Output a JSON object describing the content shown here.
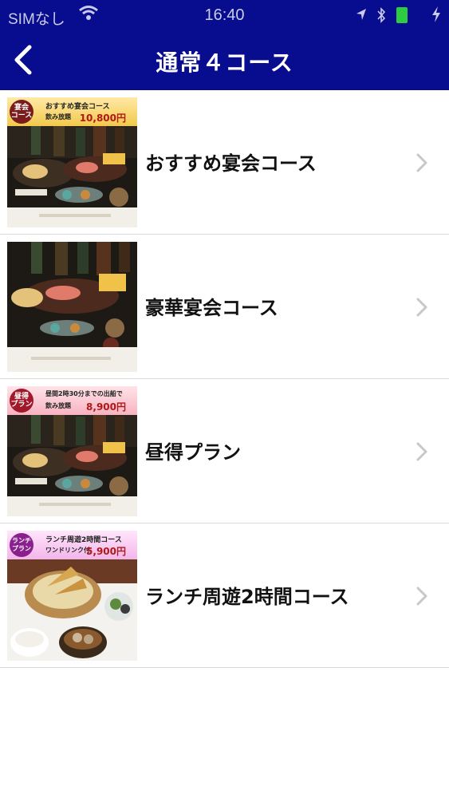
{
  "status_bar": {
    "carrier": "SIMなし",
    "time": "16:40"
  },
  "nav": {
    "title": "通常４コース"
  },
  "courses": [
    {
      "label": "おすすめ宴会コース",
      "banner": {
        "badge": "宴会\nコース",
        "line1": "おすすめ宴会コース",
        "line2": "飲み放題",
        "price": "10,800円"
      }
    },
    {
      "label": "豪華宴会コース"
    },
    {
      "label": "昼得プラン",
      "banner": {
        "badge": "昼得\nプラン",
        "line1": "昼間2時30分までの出船で",
        "line2": "飲み放題",
        "price": "8,900円"
      }
    },
    {
      "label": "ランチ周遊2時間コース",
      "banner": {
        "badge": "ランチ\nプラン",
        "line1": "ランチ周遊2時間コース",
        "line2": "ワンドリンク付",
        "price": "5,900円"
      }
    }
  ],
  "colors": {
    "header_bg": "#080d8f",
    "banner_gold": "#f2c94c",
    "banner_pink": "#f7c6cf",
    "banner_lavender": "#f6c8ef"
  }
}
